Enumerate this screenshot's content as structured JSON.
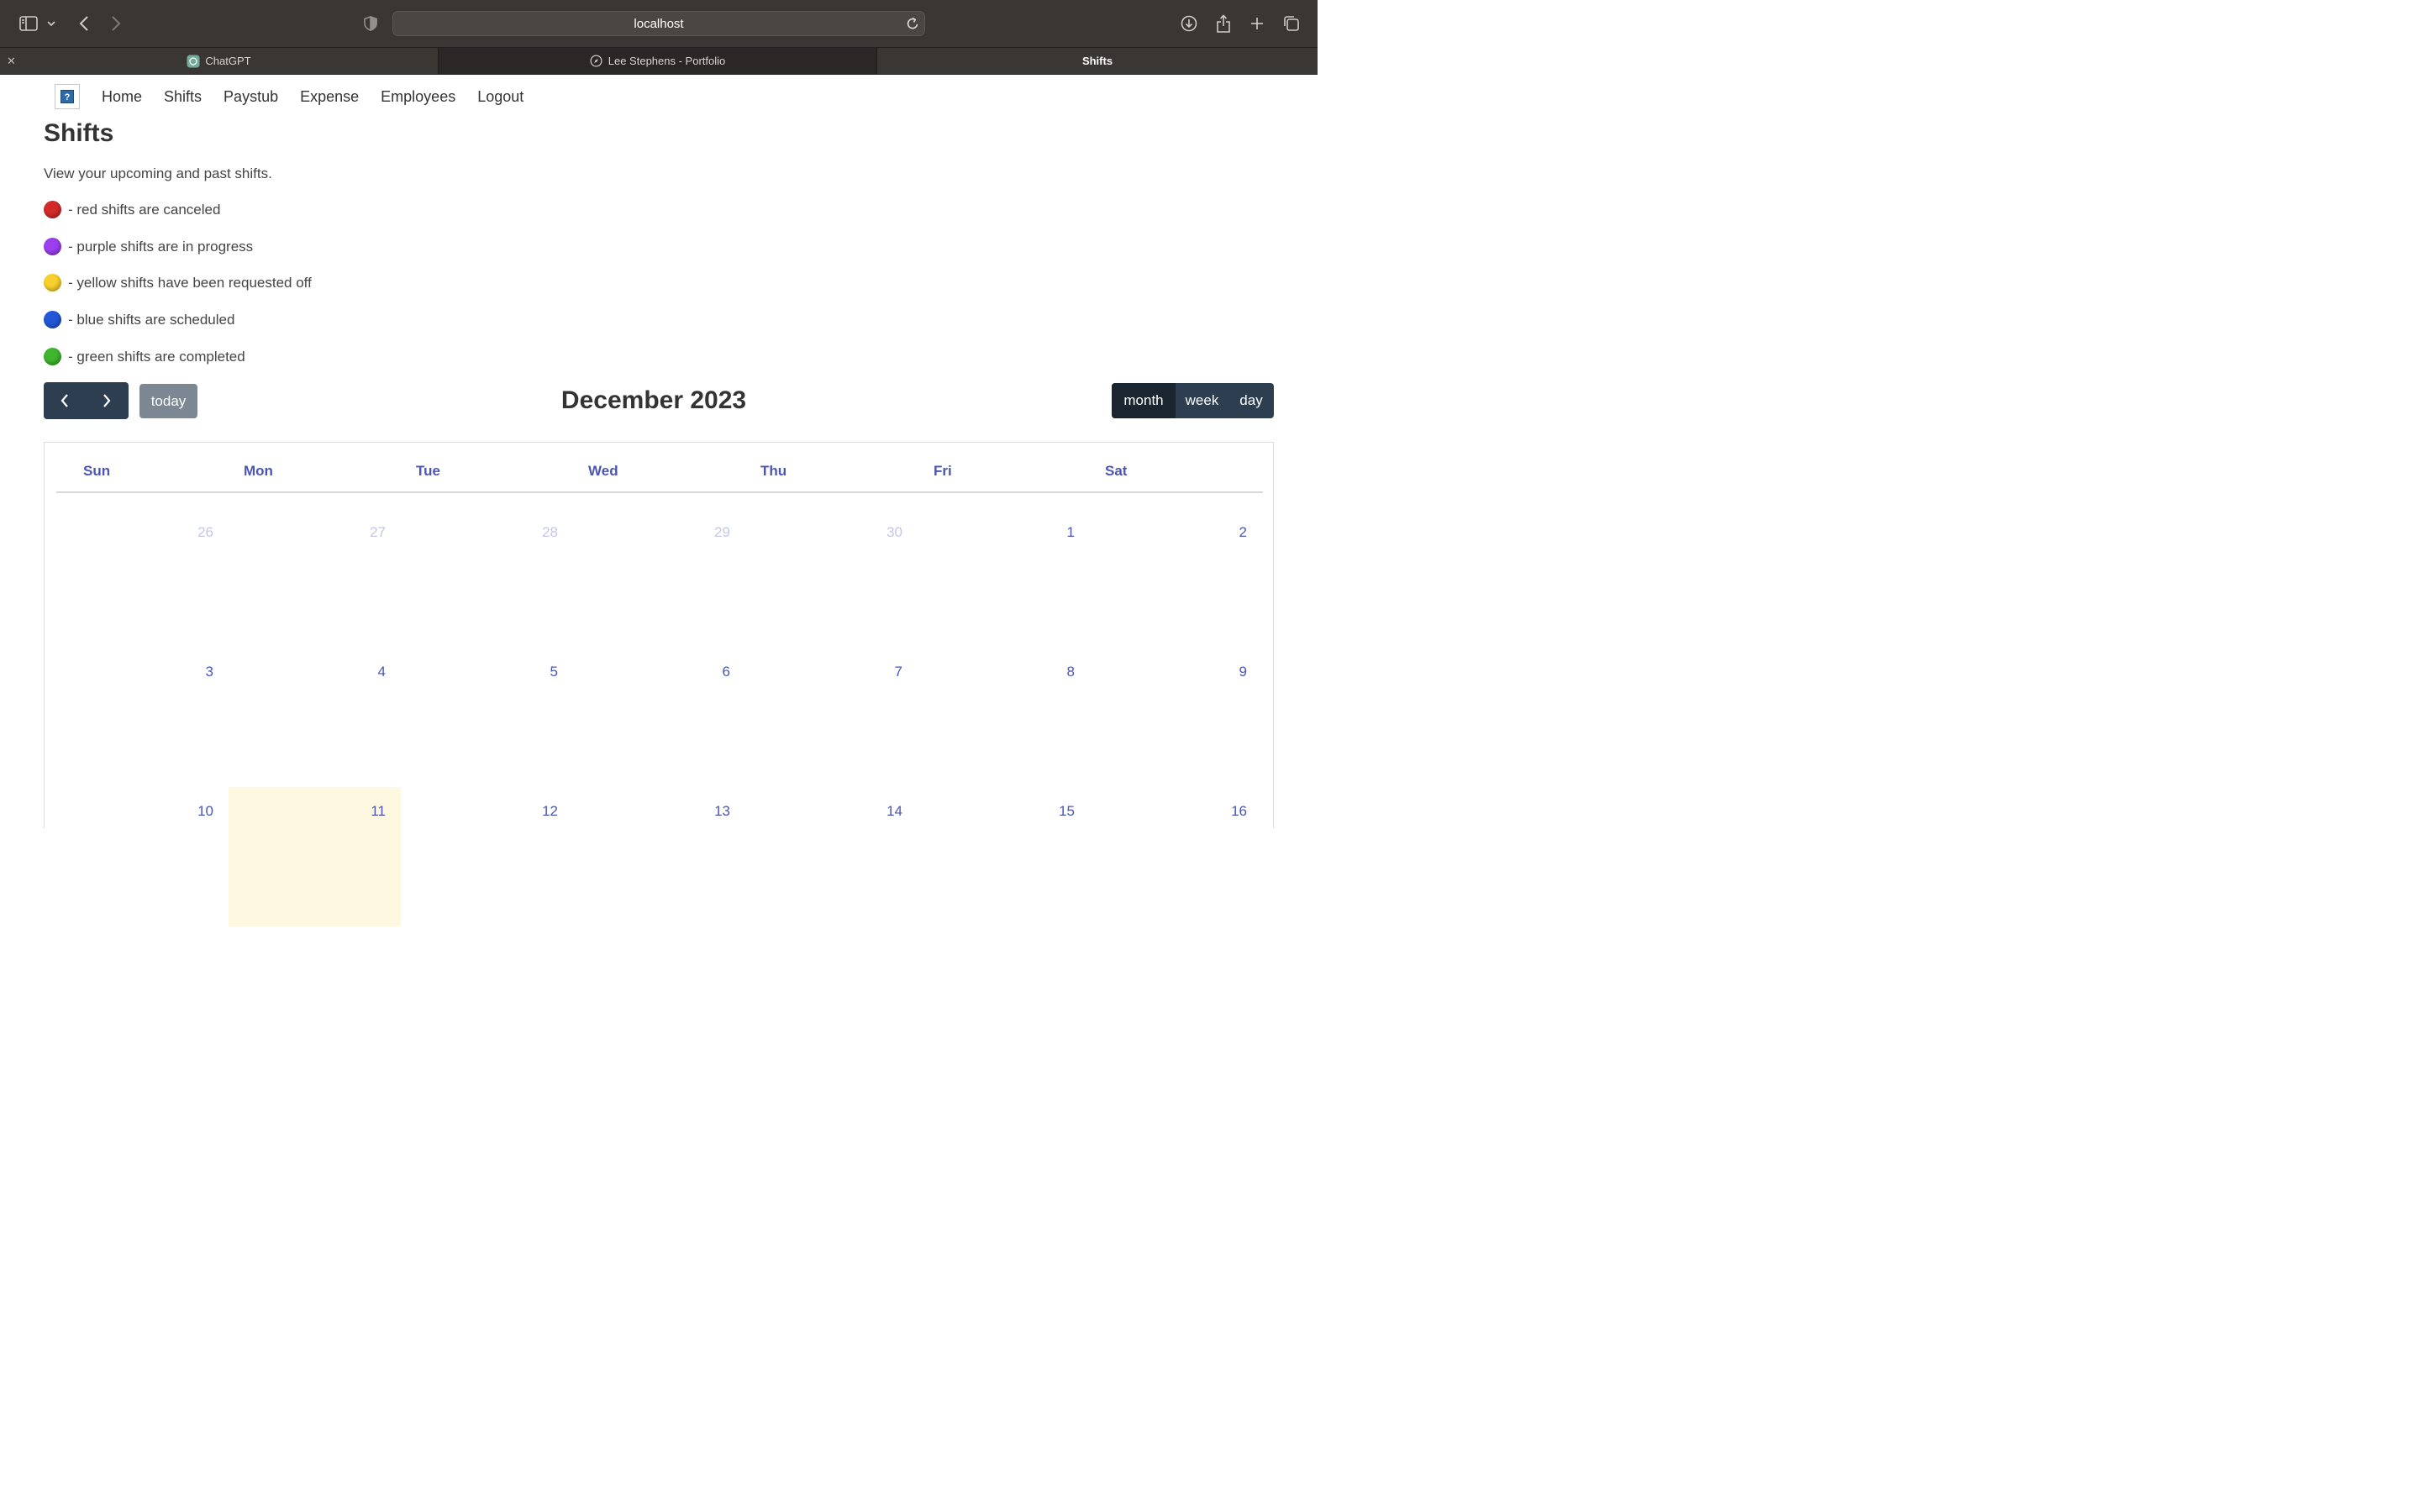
{
  "browser": {
    "url": "localhost",
    "tabs": [
      {
        "label": "ChatGPT"
      },
      {
        "label": "Lee Stephens - Portfolio"
      },
      {
        "label": "Shifts"
      }
    ]
  },
  "nav": {
    "logo_alt": "?",
    "links": [
      "Home",
      "Shifts",
      "Paystub",
      "Expense",
      "Employees",
      "Logout"
    ]
  },
  "page": {
    "title": "Shifts",
    "intro": "View your upcoming and past shifts.",
    "legend": [
      {
        "color": "#d42a2a",
        "text": "- red shifts are canceled"
      },
      {
        "color": "#9b3ff0",
        "text": "- purple shifts are in progress"
      },
      {
        "color": "#f7d02e",
        "text": "- yellow shifts have been requested off"
      },
      {
        "color": "#2357d8",
        "text": "- blue shifts are scheduled"
      },
      {
        "color": "#3fb52e",
        "text": "- green shifts are completed"
      }
    ]
  },
  "calendar": {
    "title": "December 2023",
    "today_label": "today",
    "views": [
      "month",
      "week",
      "day"
    ],
    "active_view": "month",
    "weekdays": [
      "Sun",
      "Mon",
      "Tue",
      "Wed",
      "Thu",
      "Fri",
      "Sat"
    ],
    "weeks": [
      [
        {
          "d": "26",
          "other": true
        },
        {
          "d": "27",
          "other": true
        },
        {
          "d": "28",
          "other": true
        },
        {
          "d": "29",
          "other": true
        },
        {
          "d": "30",
          "other": true
        },
        {
          "d": "1"
        },
        {
          "d": "2"
        }
      ],
      [
        {
          "d": "3"
        },
        {
          "d": "4"
        },
        {
          "d": "5"
        },
        {
          "d": "6"
        },
        {
          "d": "7"
        },
        {
          "d": "8"
        },
        {
          "d": "9"
        }
      ],
      [
        {
          "d": "10"
        },
        {
          "d": "11",
          "today": true
        },
        {
          "d": "12"
        },
        {
          "d": "13"
        },
        {
          "d": "14"
        },
        {
          "d": "15"
        },
        {
          "d": "16"
        }
      ]
    ],
    "colors": {
      "accent": "#4a55b5",
      "today_bg": "#fff8e1",
      "button": "#2c3e50"
    }
  }
}
